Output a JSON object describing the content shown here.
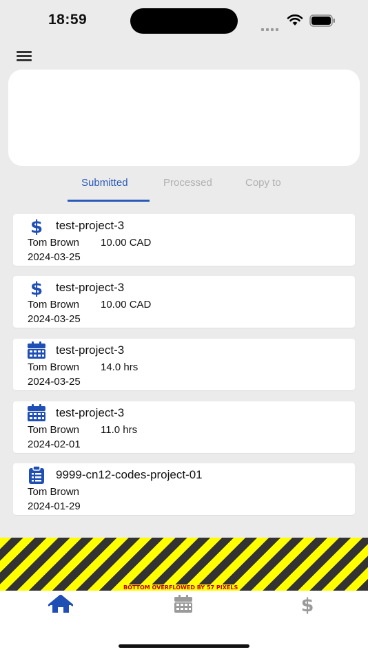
{
  "status_bar": {
    "time": "18:59"
  },
  "tabs": [
    {
      "label": "Submitted",
      "active": true
    },
    {
      "label": "Processed",
      "active": false
    },
    {
      "label": "Copy to",
      "active": false
    }
  ],
  "records": [
    {
      "icon": "dollar-icon",
      "title": "test-project-3",
      "person": "Tom Brown",
      "amount": "10.00 CAD",
      "date": "2024-03-25"
    },
    {
      "icon": "dollar-icon",
      "title": "test-project-3",
      "person": "Tom Brown",
      "amount": "10.00 CAD",
      "date": "2024-03-25"
    },
    {
      "icon": "calendar-icon",
      "title": "test-project-3",
      "person": "Tom Brown",
      "amount": "14.0 hrs",
      "date": "2024-03-25"
    },
    {
      "icon": "calendar-icon",
      "title": "test-project-3",
      "person": "Tom Brown",
      "amount": "11.0 hrs",
      "date": "2024-02-01"
    },
    {
      "icon": "clipboard-icon",
      "title": "9999-cn12-codes-project-01",
      "person": "Tom Brown",
      "amount": "",
      "date": "2024-01-29"
    }
  ],
  "overflow_warning": "BOTTOM OVERFLOWED BY 57 PIXELS",
  "bottom_nav": [
    {
      "icon": "home-icon",
      "active": true
    },
    {
      "icon": "calendar-icon",
      "active": false
    },
    {
      "icon": "dollar-icon",
      "active": false
    }
  ],
  "colors": {
    "accent": "#2a5ab8",
    "icon_blue": "#1f4fb5",
    "inactive": "#9a9a9a",
    "background": "#ebebeb"
  }
}
